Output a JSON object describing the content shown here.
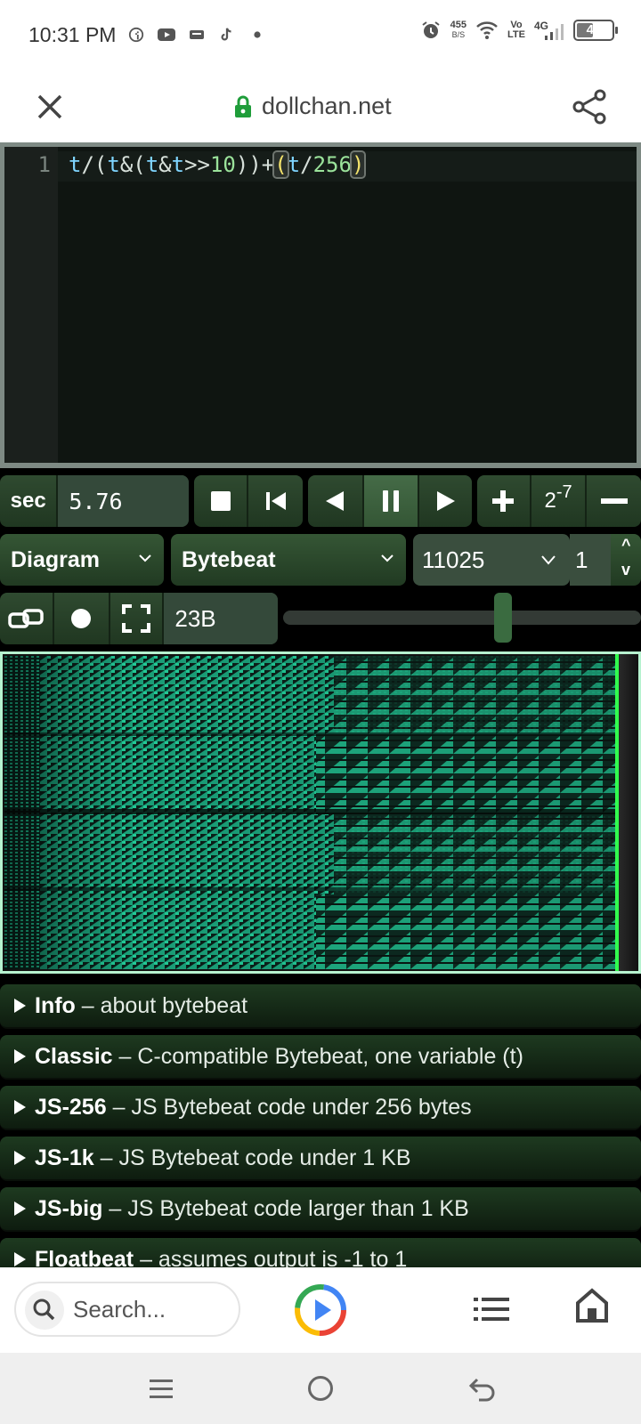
{
  "status_bar": {
    "time": "10:31 PM",
    "net_speed_value": "455",
    "net_speed_unit": "B/S",
    "volte_top": "Vo",
    "volte_bottom": "LTE",
    "network_type": "4G",
    "battery": "48",
    "battery_level": 0.48,
    "left_icons": [
      "facebook-icon",
      "youtube-icon",
      "message-icon",
      "tiktok-icon",
      "dot-icon"
    ]
  },
  "browser": {
    "domain": "dollchan.net"
  },
  "editor": {
    "line_number": "1",
    "tokens": [
      {
        "t": "t",
        "c": "var"
      },
      {
        "t": "/(",
        "c": "op"
      },
      {
        "t": "t",
        "c": "var"
      },
      {
        "t": "&(",
        "c": "op"
      },
      {
        "t": "t",
        "c": "var"
      },
      {
        "t": "&",
        "c": "op"
      },
      {
        "t": "t",
        "c": "var"
      },
      {
        "t": ">>",
        "c": "op"
      },
      {
        "t": "10",
        "c": "num"
      },
      {
        "t": "))+",
        "c": "op"
      },
      {
        "t": "(",
        "c": "bracket"
      },
      {
        "t": "t",
        "c": "var"
      },
      {
        "t": "/",
        "c": "op"
      },
      {
        "t": "256",
        "c": "num"
      },
      {
        "t": ")",
        "c": "bracket"
      }
    ]
  },
  "controls": {
    "time_unit": "sec",
    "time_value": "5.76",
    "scale_base": "2",
    "scale_exp": "-7",
    "mode": "Diagram",
    "type": "Bytebeat",
    "sample_rate": "11025",
    "divisor": "1",
    "up_arrow": "^",
    "down_arrow": "v",
    "code_size": "23B",
    "volume_level": 0.62
  },
  "library": [
    {
      "title": "Info",
      "desc": " – about bytebeat"
    },
    {
      "title": "Classic",
      "desc": " – C-compatible Bytebeat, one variable (t)"
    },
    {
      "title": "JS-256",
      "desc": " – JS Bytebeat code under 256 bytes"
    },
    {
      "title": "JS-1k",
      "desc": " – JS Bytebeat code under 1 KB"
    },
    {
      "title": "JS-big",
      "desc": " – JS Bytebeat code larger than 1 KB"
    },
    {
      "title": "Floatbeat",
      "desc": " – assumes output is -1 to 1"
    }
  ],
  "bottom_toolbar": {
    "search_placeholder": "Search..."
  },
  "colors": {
    "accent_green": "#31ff4e",
    "diagram_teal": "#1fbf8f",
    "panel_green": "#2f4a30"
  }
}
